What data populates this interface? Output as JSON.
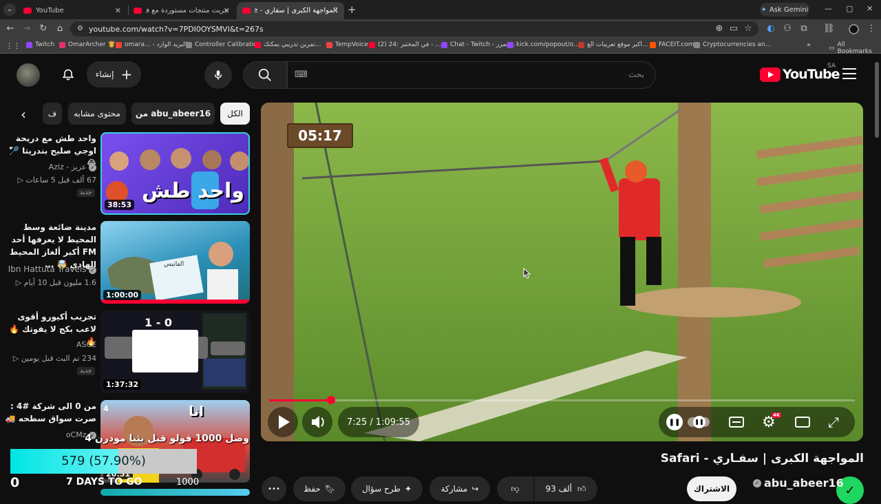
{
  "browser": {
    "tabs": [
      {
        "title": "YouTube",
        "active": false
      },
      {
        "title": "جربت منتجات مستوردة مع فيرفو...",
        "active": false
      },
      {
        "title": "المواجهة الكبرى | سفاري - Safari - YouTube",
        "active": true
      }
    ],
    "new_tab": "+",
    "ask_gemini": "Ask Gemini",
    "url": "youtube.com/watch?v=7PDI0OYSMVI&t=267s",
    "bookmarks": [
      {
        "label": "Twitch",
        "color": "#9146ff"
      },
      {
        "label": "OmarArcher 👸",
        "color": "#e1306c"
      },
      {
        "label": "omara... - البريد الوارد",
        "color": "#ea4335"
      },
      {
        "label": "Controller Calibration",
        "color": "#888888"
      },
      {
        "label": "تمرين تدريبي يمكنك...",
        "color": "#ff0033"
      },
      {
        "label": "TempVoice",
        "color": "#ed4245"
      },
      {
        "label": "(2) في المختبر :24 - ...",
        "color": "#ff0033"
      },
      {
        "label": "Chat - Twitch - عمرر...",
        "color": "#9146ff"
      },
      {
        "label": "kick.com/popout/o...",
        "color": "#9146ff"
      },
      {
        "label": "اكبر موقع تعريبات الع...",
        "color": "#c0392b"
      },
      {
        "label": "FACEIT.com",
        "color": "#ff5500"
      },
      {
        "label": "Cryptocurrencies an...",
        "color": "#888888"
      }
    ],
    "all_bookmarks": "All Bookmarks"
  },
  "masthead": {
    "logo_text": "YouTube",
    "region": "SA",
    "search_placeholder": "بحث",
    "create_label": "إنشاء"
  },
  "chips": [
    {
      "label": "الكل",
      "selected": true
    },
    {
      "label": "من abu_abeer16",
      "selected": false
    },
    {
      "label": "محتوى مشابه",
      "selected": false
    },
    {
      "label": "ف",
      "selected": false
    }
  ],
  "related": [
    {
      "title": "واحد طش مع دريحة اوجي صليح بندريتا 🏸 😂",
      "channel": "عزيز - Aziz",
      "verified": true,
      "meta": "67 ألف  قبل 5 ساعات",
      "badge": "جديد",
      "duration": "38:53",
      "thumb_text": "واحد طش",
      "thumb_color": "#6a3fd6"
    },
    {
      "title": "مدينة ضائعة وسط المحيط لا يعرفها أحد FM أكبر ألغاز المحيط الهادي 🤯 ...",
      "channel": "Ibn Hattuta Travels",
      "verified": true,
      "meta": "1.6 مليون  قبل 10 أيام",
      "badge": "",
      "duration": "1:00:00",
      "thumb_text": "الفاتيس",
      "thumb_color": "#2f7fb0"
    },
    {
      "title": "تجريب أكيورو أقوى لاعب بكج لا يفوتك 🔥 🔥",
      "channel": "ASCE",
      "verified": false,
      "meta": "234  تم البث قبل يومين",
      "badge": "جديد",
      "duration": "1:37:32",
      "thumb_text": "1 - 0",
      "thumb_color": "#1b1b2a"
    },
    {
      "title": "من 0 الى شركة #4 : صرت سواق سطحه 🚚",
      "channel": "oCMz",
      "verified": true,
      "meta": "",
      "badge": "",
      "duration": "20:51",
      "thumb_text": "انا",
      "thumb_color": "#c62828"
    }
  ],
  "player": {
    "timer_sign": "05:17",
    "time_display": "7:25 / 1:09:55",
    "progress": 0.106,
    "quality_badge": "4K"
  },
  "video": {
    "title": "المواجهة الكبرى | سفـاري - Safari",
    "channel": "abu_abeer16",
    "subscribe": "الاشتراك",
    "likes": "93 ألف",
    "share": "مشاركة",
    "ask": "طرح سؤال",
    "save": "حفظ",
    "more": "•••"
  },
  "overlay": {
    "goal_text": "وصل 1000 فولو قبل بثنا مودرن 4",
    "progress_text": "579 (57.90%)",
    "progress": 0.579,
    "start": "0",
    "days": "7 DAYS TO GO",
    "target": "1000"
  },
  "colors": {
    "yt_red": "#ff0033",
    "overlay_cyan": "#00e5e5"
  }
}
